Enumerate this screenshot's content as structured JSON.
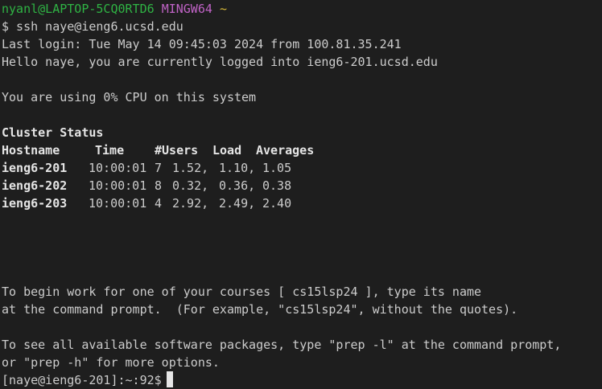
{
  "terminal": {
    "prompt_header": {
      "user_host": "nyanl@LAPTOP-5CQ0RTD6",
      "env": "MINGW64",
      "path": "~"
    },
    "command_line": "$ ssh naye@ieng6.ucsd.edu",
    "last_login": "Last login: Tue May 14 09:45:03 2024 from 100.81.35.241",
    "hello": "Hello naye, you are currently logged into ieng6-201.ucsd.edu",
    "cpu_usage": "You are using 0% CPU on this system",
    "cluster_title": "Cluster Status",
    "cluster_headers": [
      "Hostname",
      "Time",
      "#Users",
      "Load",
      "Averages"
    ],
    "cluster_rows": [
      {
        "host": "ieng6-201",
        "time": "10:00:01",
        "users": "7",
        "l1": "1.52,",
        "l5": "1.10,",
        "l15": "1.05"
      },
      {
        "host": "ieng6-202",
        "time": "10:00:01",
        "users": "8",
        "l1": "0.32,",
        "l5": "0.36,",
        "l15": "0.38"
      },
      {
        "host": "ieng6-203",
        "time": "10:00:01",
        "users": "4",
        "l1": "2.92,",
        "l5": "2.49,",
        "l15": "2.40"
      }
    ],
    "courses_line1": "To begin work for one of your courses [ cs15lsp24 ], type its name",
    "courses_line2": "at the command prompt.  (For example, \"cs15lsp24\", without the quotes).",
    "prep_line1": "To see all available software packages, type \"prep -l\" at the command prompt,",
    "prep_line2": "or \"prep -h\" for more options.",
    "remote_prompt": "[naye@ieng6-201]:~:92$"
  }
}
